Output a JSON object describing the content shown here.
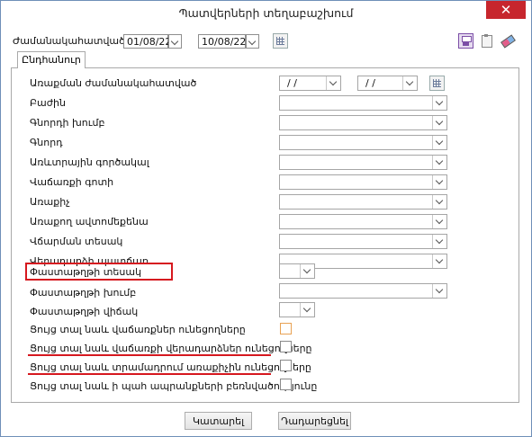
{
  "window": {
    "title": "Պատվերների տեղաբաշխում",
    "close_glyph": "✕"
  },
  "header": {
    "period_label": "Ժամանակահատված",
    "date_from": "01/08/22",
    "date_to": "10/08/22"
  },
  "tabs": [
    {
      "label": "Ընդհանուր"
    }
  ],
  "form": {
    "period_label": "Առաքման ժամանակահատված",
    "period_from": "/ /",
    "period_to": "/ /",
    "fields": [
      {
        "label": "Բաժին"
      },
      {
        "label": "Գնորդի խումբ"
      },
      {
        "label": "Գնորդ"
      },
      {
        "label": "Առևտրային գործակալ"
      },
      {
        "label": "Վաճառքի գոտի"
      },
      {
        "label": "Առաքիչ"
      },
      {
        "label": "Առաքող ավտոմեքենա"
      },
      {
        "label": "Վճարման տեսակ"
      },
      {
        "label": "Վերադարձի պատճառ"
      },
      {
        "label": "Փաստաթղթի տեսակ"
      },
      {
        "label": "Փաստաթղթի խումբ"
      },
      {
        "label": "Փաստաթղթի վիճակ"
      }
    ],
    "checkboxes": [
      {
        "label": "Ցույց տալ նաև վաճառքներ ունեցողները",
        "checked": false
      },
      {
        "label": "Ցույց տալ նաև վաճառքի վերադարձներ ունեցողները",
        "checked": false
      },
      {
        "label": "Ցույց տալ նաև տրամադրում առաքիչին ունեցողները",
        "checked": false
      },
      {
        "label": "Ցույց տալ նաև ի պահ ապրանքների բեռնվածությունը",
        "checked": false
      }
    ]
  },
  "footer": {
    "execute_label": "Կատարել",
    "reset_label": "Դադարեցնել"
  },
  "colors": {
    "highlight": "#d6181f",
    "close_bg": "#c7262d"
  }
}
